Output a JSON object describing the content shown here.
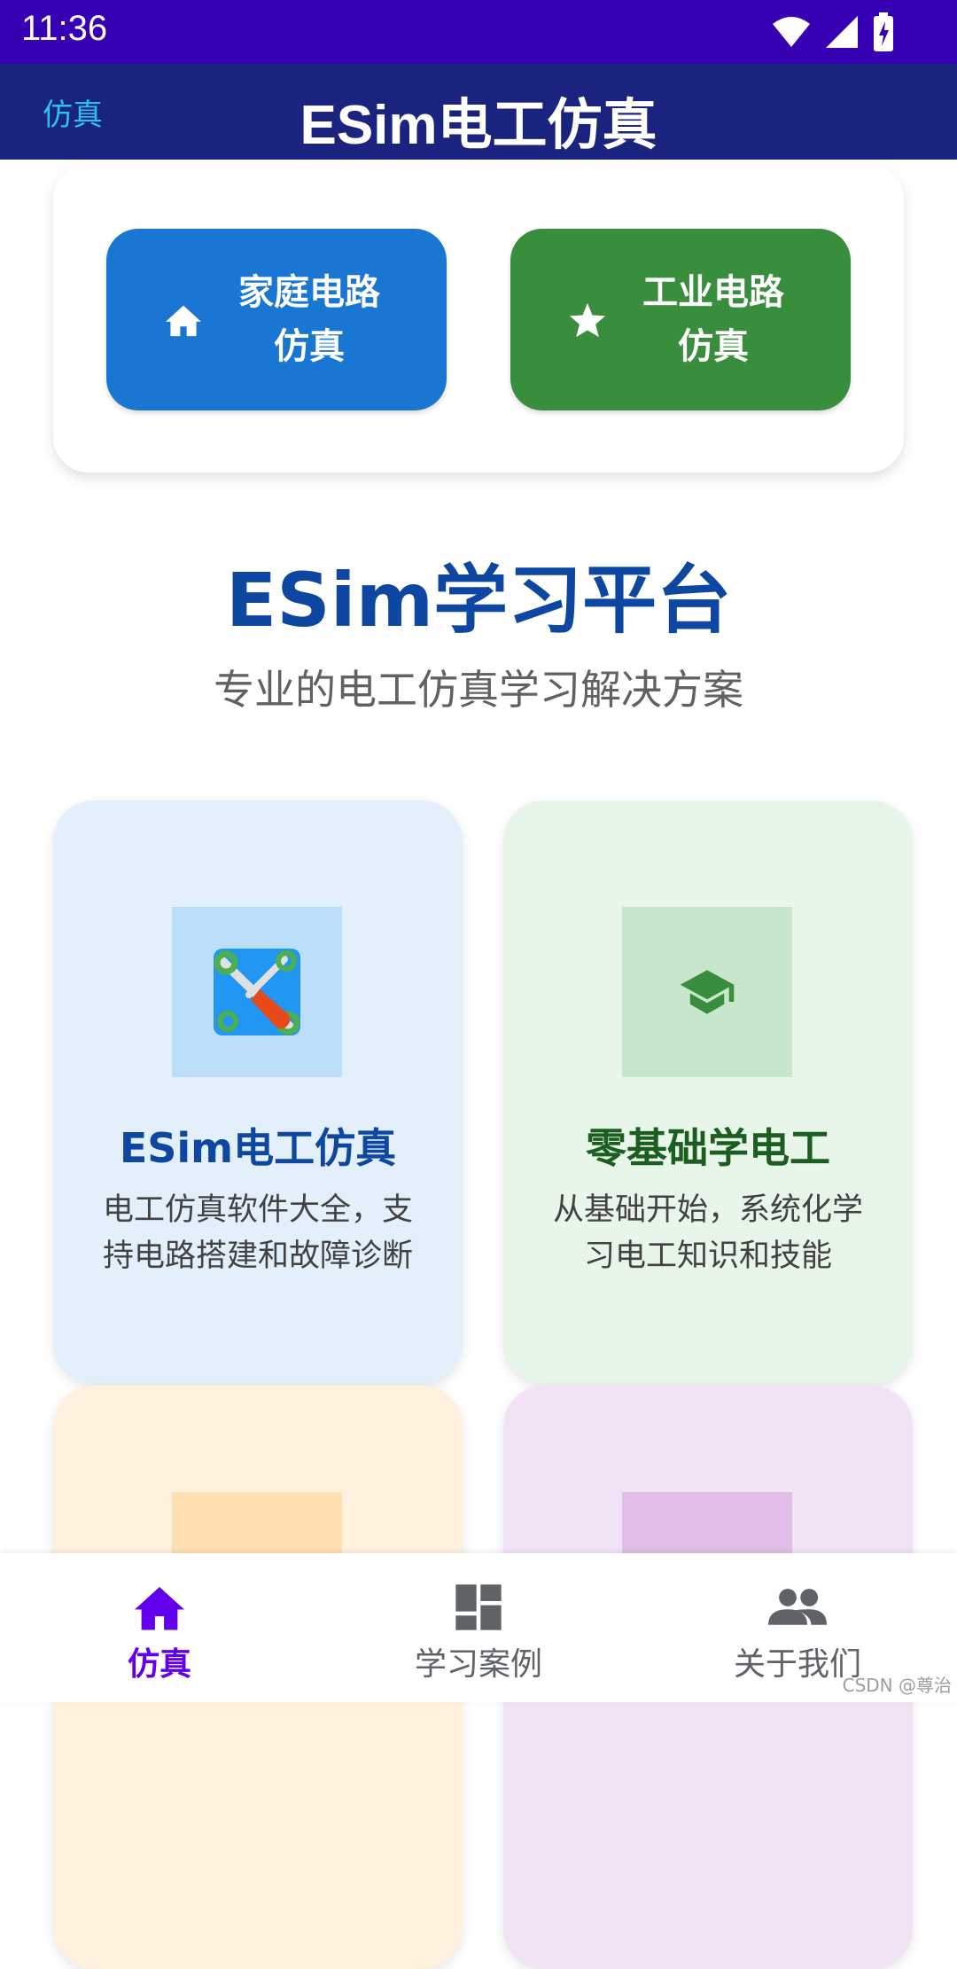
{
  "status_bar": {
    "time": "11:36"
  },
  "toolbar": {
    "tab_label": "仿真",
    "title": "ESim电工仿真"
  },
  "sim_buttons": [
    {
      "line1": "家庭电路",
      "line2": "仿真",
      "color": "#1976d2",
      "icon": "home-icon"
    },
    {
      "line1": "工业电路",
      "line2": "仿真",
      "color": "#388e3c",
      "icon": "star-icon"
    }
  ],
  "platform": {
    "title": "ESim学习平台",
    "subtitle": "专业的电工仿真学习解决方案"
  },
  "cards": [
    {
      "title": "ESim电工仿真",
      "desc": "电工仿真软件大全，支持电路搭建和故障诊断",
      "bg": "#e3f0fc",
      "icon": "tools-icon"
    },
    {
      "title": "零基础学电工",
      "desc": "从基础开始，系统化学习电工知识和技能",
      "bg": "#e8f5e9",
      "icon": "graduation-cap-icon"
    }
  ],
  "bottom_nav": [
    {
      "label": "仿真",
      "icon": "home-icon",
      "active": true
    },
    {
      "label": "学习案例",
      "icon": "dashboard-icon",
      "active": false
    },
    {
      "label": "关于我们",
      "icon": "people-icon",
      "active": false
    }
  ],
  "watermark": "CSDN @尊治"
}
